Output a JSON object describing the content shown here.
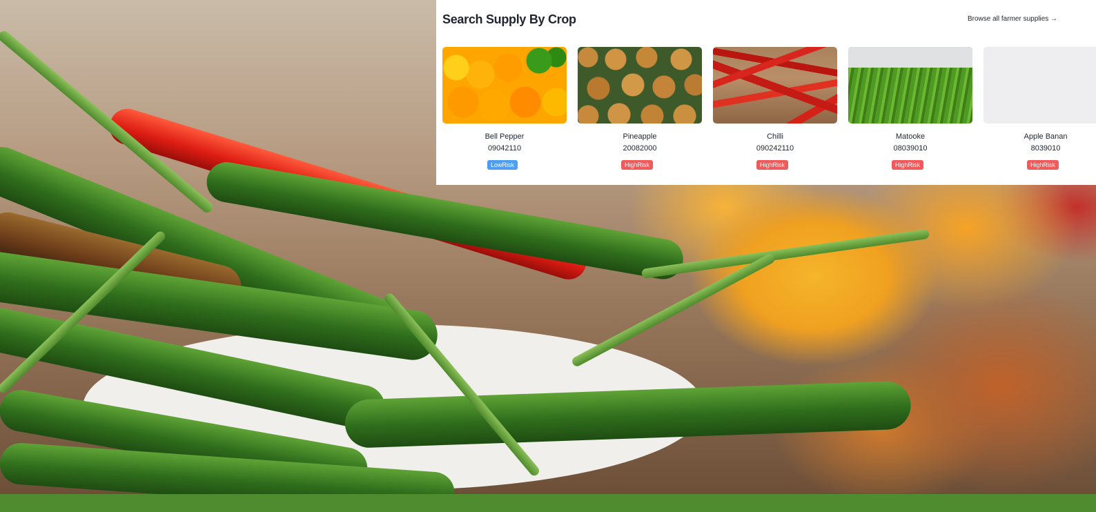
{
  "panel": {
    "title": "Search Supply By Crop",
    "browse_link": "Browse all farmer supplies →"
  },
  "crops": [
    {
      "name": "Bell Pepper",
      "code": "09042110",
      "risk": "LowRisk",
      "risk_color": "#4f9df0",
      "image": "bell-pepper-image"
    },
    {
      "name": "Pineapple",
      "code": "20082000",
      "risk": "HighRisk",
      "risk_color": "#ef5b5b",
      "image": "pineapple-image"
    },
    {
      "name": "Chilli",
      "code": "090242110",
      "risk": "HighRisk",
      "risk_color": "#ef5b5b",
      "image": "chilli-image"
    },
    {
      "name": "Matooke",
      "code": "08039010",
      "risk": "HighRisk",
      "risk_color": "#ef5b5b",
      "image": "matooke-image"
    },
    {
      "name": "Apple Banan",
      "code": "8039010",
      "risk": "HighRisk",
      "risk_color": "#ef5b5b",
      "image": "apple-banana-image"
    }
  ],
  "colors": {
    "footer_bar": "#4e8c2f",
    "low_risk": "#4f9df0",
    "high_risk": "#ef5b5b"
  }
}
